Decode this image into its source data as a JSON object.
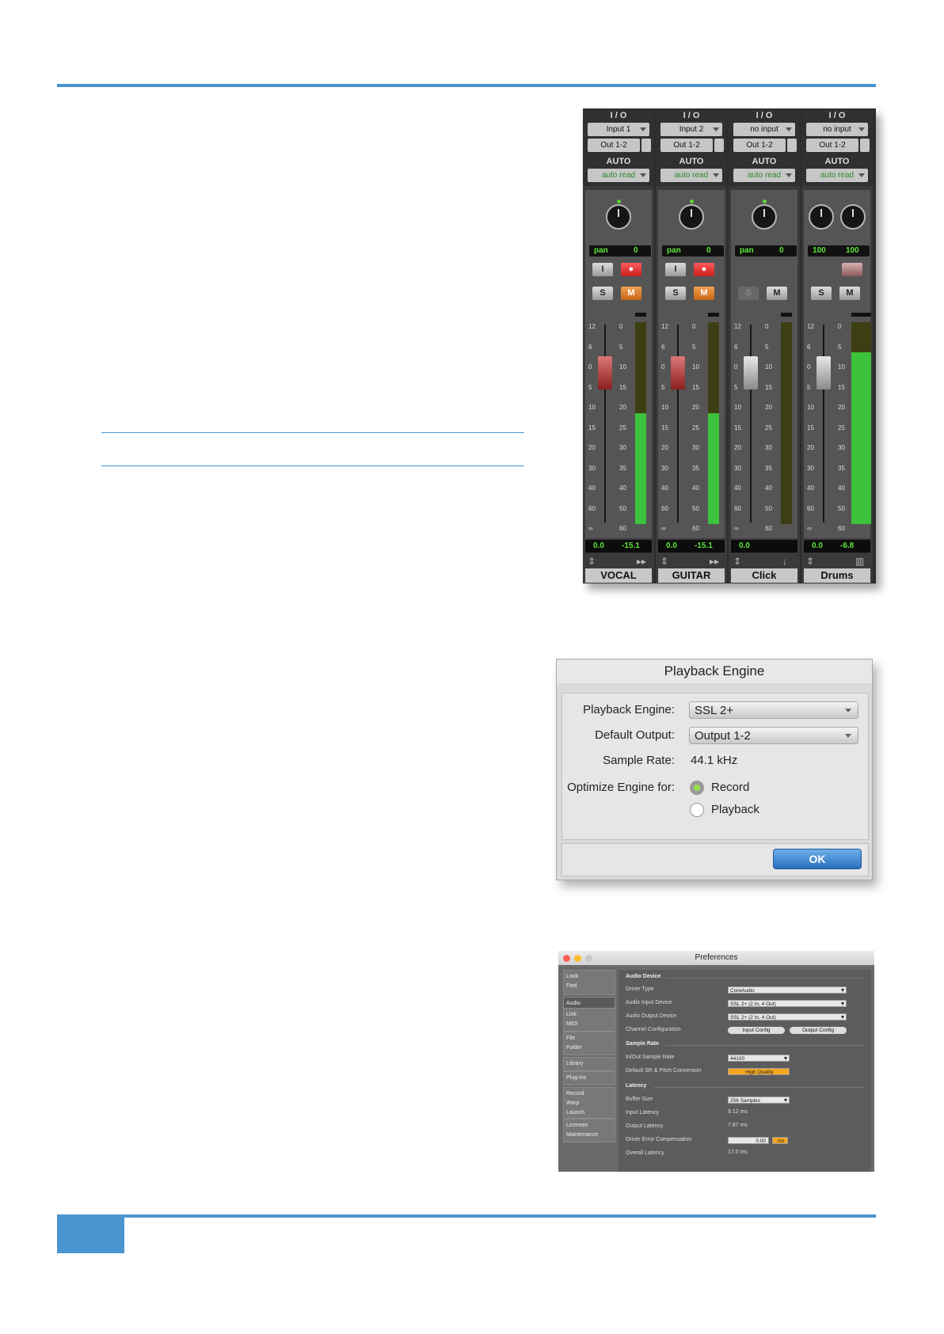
{
  "mixer": {
    "io_label": "I / O",
    "auto_label": "AUTO",
    "strips": [
      {
        "name": "VOCAL",
        "input": "Input 1",
        "output": "Out 1-2",
        "auto": "auto read",
        "pan_label": "pan",
        "pan_value": "0",
        "vol": "0.0",
        "peak": "-15.1",
        "meter_level": 0.55,
        "color": "red",
        "has_input_btn": true,
        "has_rec": true,
        "mute_on": true
      },
      {
        "name": "GUITAR",
        "input": "Input 2",
        "output": "Out 1-2",
        "auto": "auto read",
        "pan_label": "pan",
        "pan_value": "0",
        "vol": "0.0",
        "peak": "-15.1",
        "meter_level": 0.55,
        "color": "red",
        "has_input_btn": true,
        "has_rec": true,
        "mute_on": true
      },
      {
        "name": "Click",
        "input": "no input",
        "output": "Out 1-2",
        "auto": "auto read",
        "pan_label": "pan",
        "pan_value": "0",
        "vol": "0.0",
        "peak": "",
        "meter_level": 0,
        "color": "grey",
        "has_input_btn": false,
        "has_rec": false,
        "mute_on": false
      },
      {
        "name": "Drums",
        "input": "no input",
        "output": "Out 1-2",
        "auto": "auto read",
        "pan_left": "100",
        "pan_right": "100",
        "vol": "0.0",
        "peak": "-6.8",
        "meter_level": 0.85,
        "color": "grey",
        "has_input_btn": false,
        "has_rec": false,
        "mute_on": false
      }
    ],
    "buttons": {
      "input": "I",
      "solo": "S",
      "mute": "M"
    },
    "scale_left": [
      "12",
      "6",
      "0",
      "5",
      "10",
      "15",
      "20",
      "30",
      "40",
      "60",
      "∞"
    ],
    "scale_right": [
      "0",
      "5",
      "10",
      "15",
      "20",
      "25",
      "30",
      "35",
      "40",
      "50",
      "60"
    ]
  },
  "playback_engine": {
    "title": "Playback Engine",
    "engine_label": "Playback Engine:",
    "engine_value": "SSL 2+",
    "output_label": "Default Output:",
    "output_value": "Output 1-2",
    "rate_label": "Sample Rate:",
    "rate_value": "44.1 kHz",
    "optimize_label": "Optimize Engine for:",
    "option_record": "Record",
    "option_playback": "Playback",
    "ok": "OK"
  },
  "preferences": {
    "title": "Preferences",
    "sidebar": [
      "Look\nFeel",
      "Audio",
      "Link\nMIDI",
      "File\nFolder",
      "Library",
      "Plug-ins",
      "Record\nWarp\nLaunch",
      "Licenses\nMaintenance"
    ],
    "audio_device": "Audio Device",
    "driver_type_label": "Driver Type",
    "driver_type": "CoreAudio",
    "input_device_label": "Audio Input Device",
    "input_device": "SSL 2+ (2 In, 4 Out)",
    "output_device_label": "Audio Output Device",
    "output_device": "SSL 2+ (2 In, 4 Out)",
    "channel_config_label": "Channel Configuration",
    "input_config": "Input Config",
    "output_config": "Output Config",
    "sample_rate": "Sample Rate",
    "inout_rate_label": "In/Out Sample Rate",
    "inout_rate": "44100",
    "sr_conv_label": "Default SR & Pitch Conversion",
    "sr_conv": "High Quality",
    "latency": "Latency",
    "buffer_label": "Buffer Size",
    "buffer": "256 Samples",
    "input_latency_label": "Input Latency",
    "input_latency": "9.12 ms",
    "output_latency_label": "Output Latency",
    "output_latency": "7.87 ms",
    "driver_comp_label": "Driver Error Compensation",
    "driver_comp": "0.00",
    "driver_comp_unit": "ms",
    "overall_label": "Overall Latency",
    "overall": "17.0 ms"
  },
  "colors": {
    "accent": "#4a95cf",
    "meter": "#3cc23c",
    "pan_text": "#5de83c",
    "rec": "#d83030",
    "mute": "#e07c28"
  }
}
